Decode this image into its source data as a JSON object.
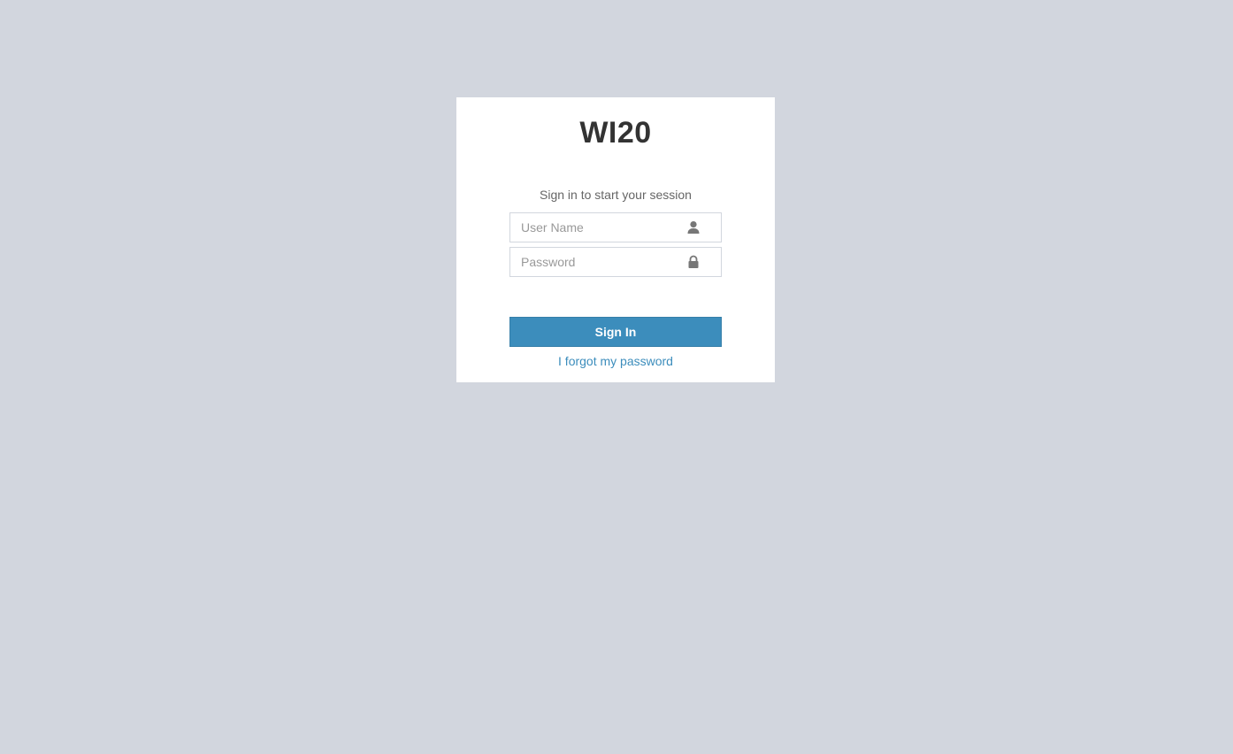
{
  "app": {
    "logo_text": "WI20",
    "login_message": "Sign in to start your session"
  },
  "form": {
    "username": {
      "placeholder": "User Name",
      "value": "",
      "icon": "user-icon"
    },
    "password": {
      "placeholder": "Password",
      "value": "",
      "icon": "lock-icon"
    },
    "submit_label": "Sign In",
    "forgot_label": "I forgot my password"
  },
  "colors": {
    "background": "#d2d6de",
    "primary": "#3c8dbc",
    "icon": "#777777"
  }
}
